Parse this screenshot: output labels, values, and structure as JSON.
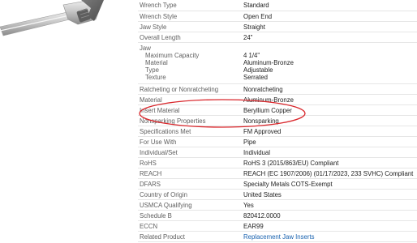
{
  "specs_top": [
    {
      "label": "Wrench Type",
      "value": "Standard"
    },
    {
      "label": "Wrench Style",
      "value": "Open End"
    },
    {
      "label": "Jaw Style",
      "value": "Straight"
    },
    {
      "label": "Overall Length",
      "value": "24\""
    }
  ],
  "jaw": {
    "label": "Jaw",
    "subs": [
      {
        "label": "Maximum Capacity",
        "value": "4 1/4\""
      },
      {
        "label": "Material",
        "value": "Aluminum-Bronze"
      },
      {
        "label": "Type",
        "value": "Adjustable"
      },
      {
        "label": "Texture",
        "value": "Serrated"
      }
    ]
  },
  "specs_bottom": [
    {
      "label": "Ratcheting or Nonratcheting",
      "value": "Nonratcheting"
    },
    {
      "label": "Material",
      "value": "Aluminum-Bronze"
    },
    {
      "label": "Insert Material",
      "value": "Beryllium Copper"
    },
    {
      "label": "Nonsparking Properties",
      "value": "Nonsparking"
    },
    {
      "label": "Specifications Met",
      "value": "FM Approved"
    },
    {
      "label": "For Use With",
      "value": "Pipe"
    },
    {
      "label": "Individual/Set",
      "value": "Individual"
    },
    {
      "label": "RoHS",
      "value": "RoHS 3 (2015/863/EU) Compliant"
    },
    {
      "label": "REACH",
      "value": "REACH (EC 1907/2006) (01/17/2023, 233 SVHC) Compliant"
    },
    {
      "label": "DFARS",
      "value": "Specialty Metals COTS-Exempt"
    },
    {
      "label": "Country of Origin",
      "value": "United States"
    },
    {
      "label": "USMCA Qualifying",
      "value": "Yes"
    },
    {
      "label": "Schedule B",
      "value": "820412.0000"
    },
    {
      "label": "ECCN",
      "value": "EAR99"
    }
  ],
  "related": {
    "label": "Related Product",
    "value": "Replacement Jaw Inserts"
  },
  "colors": {
    "link": "#1a63b0",
    "annotation": "#d9262b",
    "divider": "#e6e6e6"
  }
}
